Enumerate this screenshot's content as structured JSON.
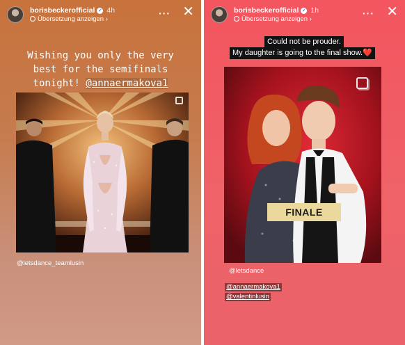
{
  "left_story": {
    "username": "borisbeckerofficial",
    "time": "4h",
    "translate_label": "Übersetzung anzeigen",
    "more_icon": "more-horizontal-icon",
    "close_icon": "close-icon",
    "caption_line1": "Wishing you only the very",
    "caption_line2": "best for the semifinals",
    "caption_line3a": "tonight!",
    "caption_mention": "@annaermakova1",
    "photo_tag": "@letsdance_teamlusin"
  },
  "right_story": {
    "username": "borisbeckerofficial",
    "time": "1h",
    "translate_label": "Übersetzung anzeigen",
    "more_icon": "more-horizontal-icon",
    "close_icon": "close-icon",
    "quote_line1": "Could not be prouder.",
    "quote_line2": "My daughter is going to the final show.",
    "quote_emoji": "❤️",
    "finale_label": "FINALE",
    "source_tag": "@letsdance",
    "mention_1": "@annaermakova1",
    "mention_2": "@valentinlusin"
  },
  "colors": {
    "left_bg_top": "#c8723c",
    "left_bg_bottom": "#d19a88",
    "right_bg": "#ef5a62",
    "finale_gold": "#ead89d",
    "photo_right_bg": "#7d0f18"
  }
}
